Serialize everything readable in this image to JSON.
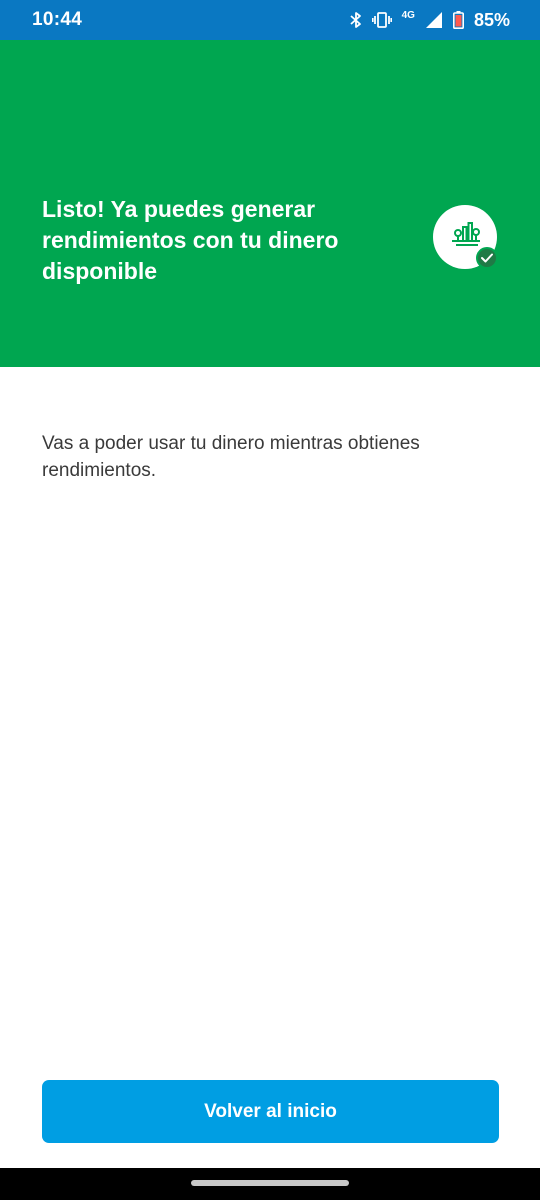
{
  "status_bar": {
    "time": "10:44",
    "network": "4G",
    "battery": "85%",
    "icons": [
      "bluetooth-icon",
      "vibrate-icon",
      "signal-icon",
      "battery-icon"
    ]
  },
  "hero": {
    "title": "Listo! Ya puedes generar rendimientos con tu dinero disponible",
    "icon": "investment-icon",
    "badge_icon": "check-icon",
    "background": "#00a650"
  },
  "message": {
    "text": "Vas a poder usar tu dinero mientras obtienes rendimientos."
  },
  "actions": {
    "primary_label": "Volver al inicio",
    "primary_color": "#009ee3"
  }
}
